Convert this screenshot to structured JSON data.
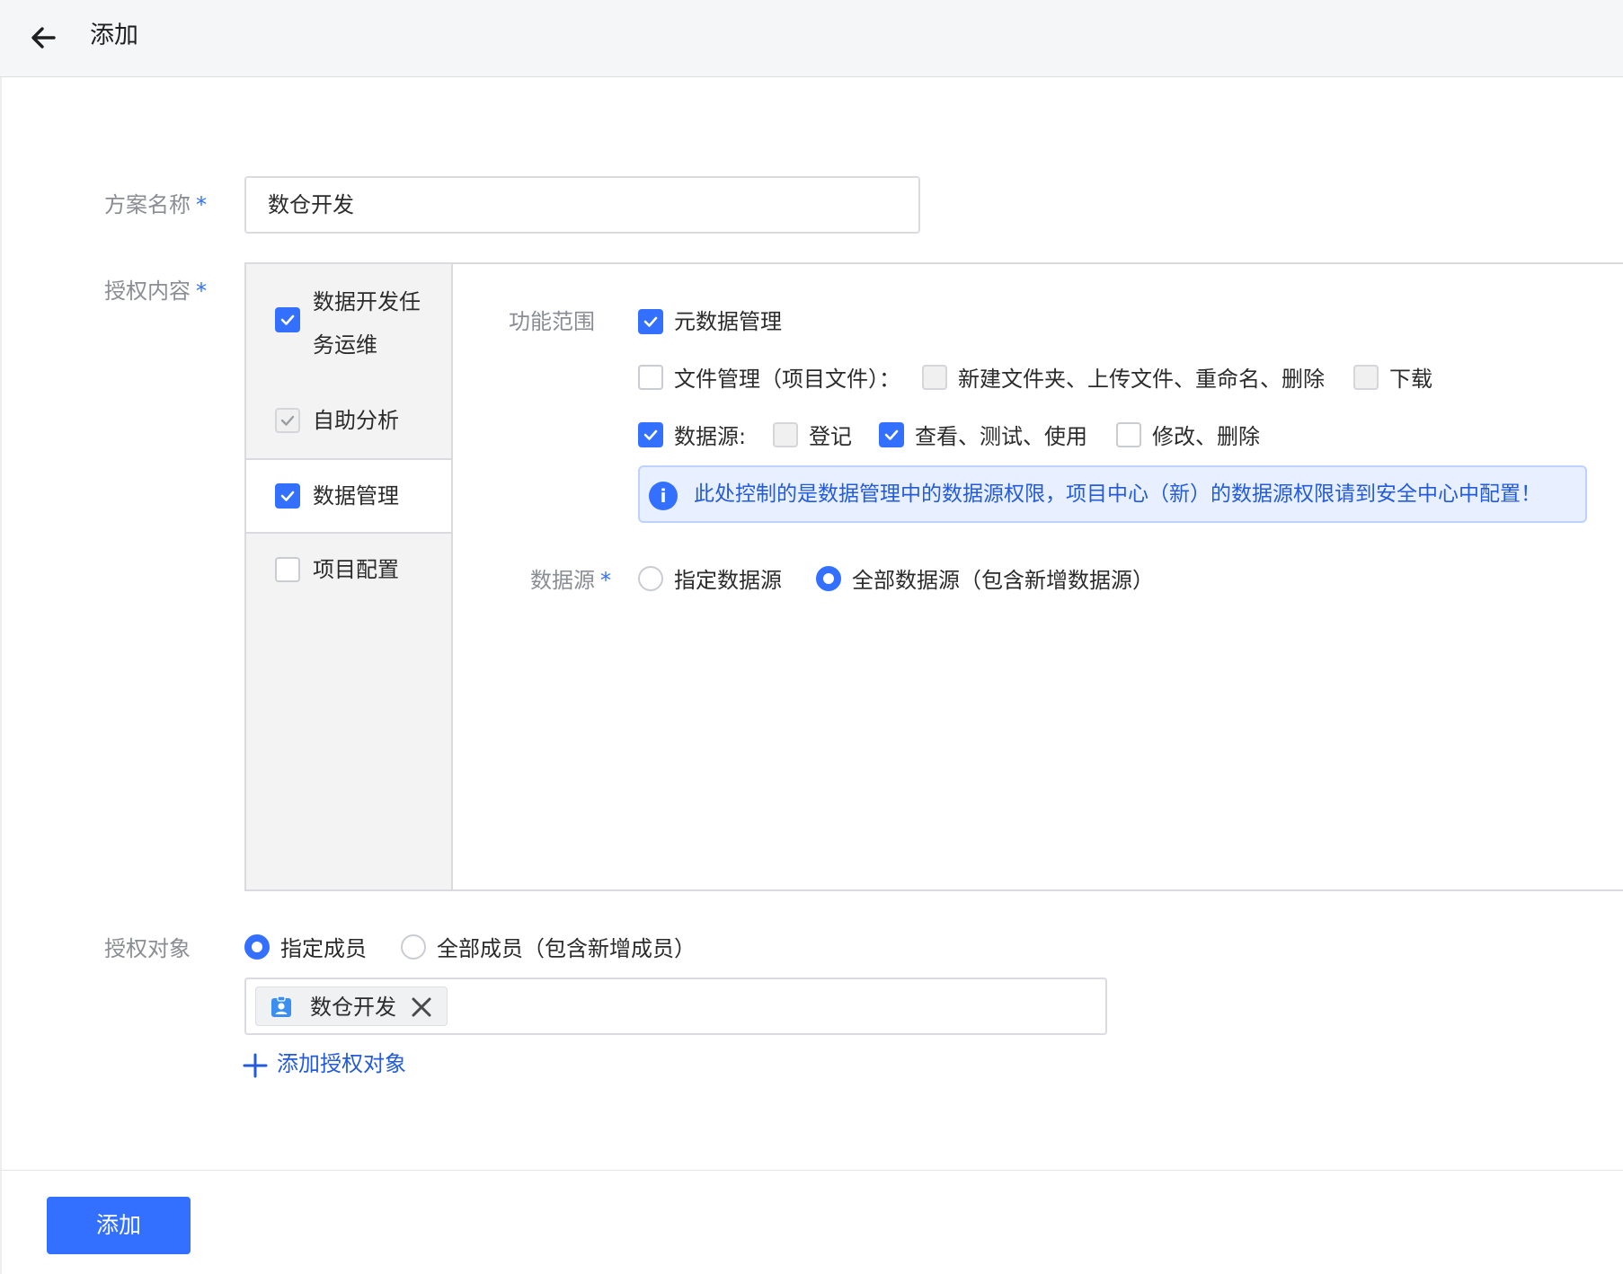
{
  "header": {
    "title": "添加"
  },
  "form": {
    "scheme_name_label": "方案名称",
    "scheme_name_value": "数仓开发",
    "required_mark": "*",
    "auth_content_label": "授权内容",
    "auth_target_label": "授权对象"
  },
  "sidebar": {
    "items": [
      {
        "label": "数据开发任务运维",
        "label_line1": "数据开发任",
        "label_line2": "务运维",
        "checked": true,
        "active": false
      },
      {
        "label": "自助分析",
        "checked": true,
        "disabled": true,
        "active": false
      },
      {
        "label": "数据管理",
        "checked": true,
        "active": true
      },
      {
        "label": "项目配置",
        "checked": false,
        "active": false
      }
    ]
  },
  "data_management": {
    "scope_label": "功能范围",
    "metadata": {
      "label": "元数据管理",
      "checked": true
    },
    "file_mgmt": {
      "label": "文件管理（项目文件）：",
      "checked": false,
      "sub_options": [
        {
          "label": "新建文件夹、上传文件、重命名、删除",
          "checked": false,
          "disabled": true
        },
        {
          "label": "下载",
          "checked": false,
          "disabled": true
        }
      ]
    },
    "datasource": {
      "label": "数据源:",
      "checked": true,
      "sub_options": [
        {
          "label": "登记",
          "checked": false,
          "disabled": true
        },
        {
          "label": "查看、测试、使用",
          "checked": true
        },
        {
          "label": "修改、删除",
          "checked": false
        }
      ]
    },
    "info": {
      "icon": "i",
      "text": "此处控制的是数据管理中的数据源权限，项目中心（新）的数据源权限请到安全中心中配置！"
    },
    "datasource_scope": {
      "label": "数据源",
      "options": [
        {
          "label": "指定数据源",
          "selected": false
        },
        {
          "label": "全部数据源（包含新增数据源）",
          "selected": true
        }
      ]
    }
  },
  "auth_target": {
    "options": [
      {
        "label": "指定成员",
        "selected": true
      },
      {
        "label": "全部成员（包含新增成员）",
        "selected": false
      }
    ],
    "tags": [
      {
        "label": "数仓开发",
        "icon": "user-badge-icon"
      }
    ],
    "add_link": "添加授权对象"
  },
  "footer": {
    "submit_label": "添加"
  },
  "colors": {
    "primary": "#3370ff",
    "link": "#245bdb",
    "info_bg": "#e8f0ff"
  }
}
